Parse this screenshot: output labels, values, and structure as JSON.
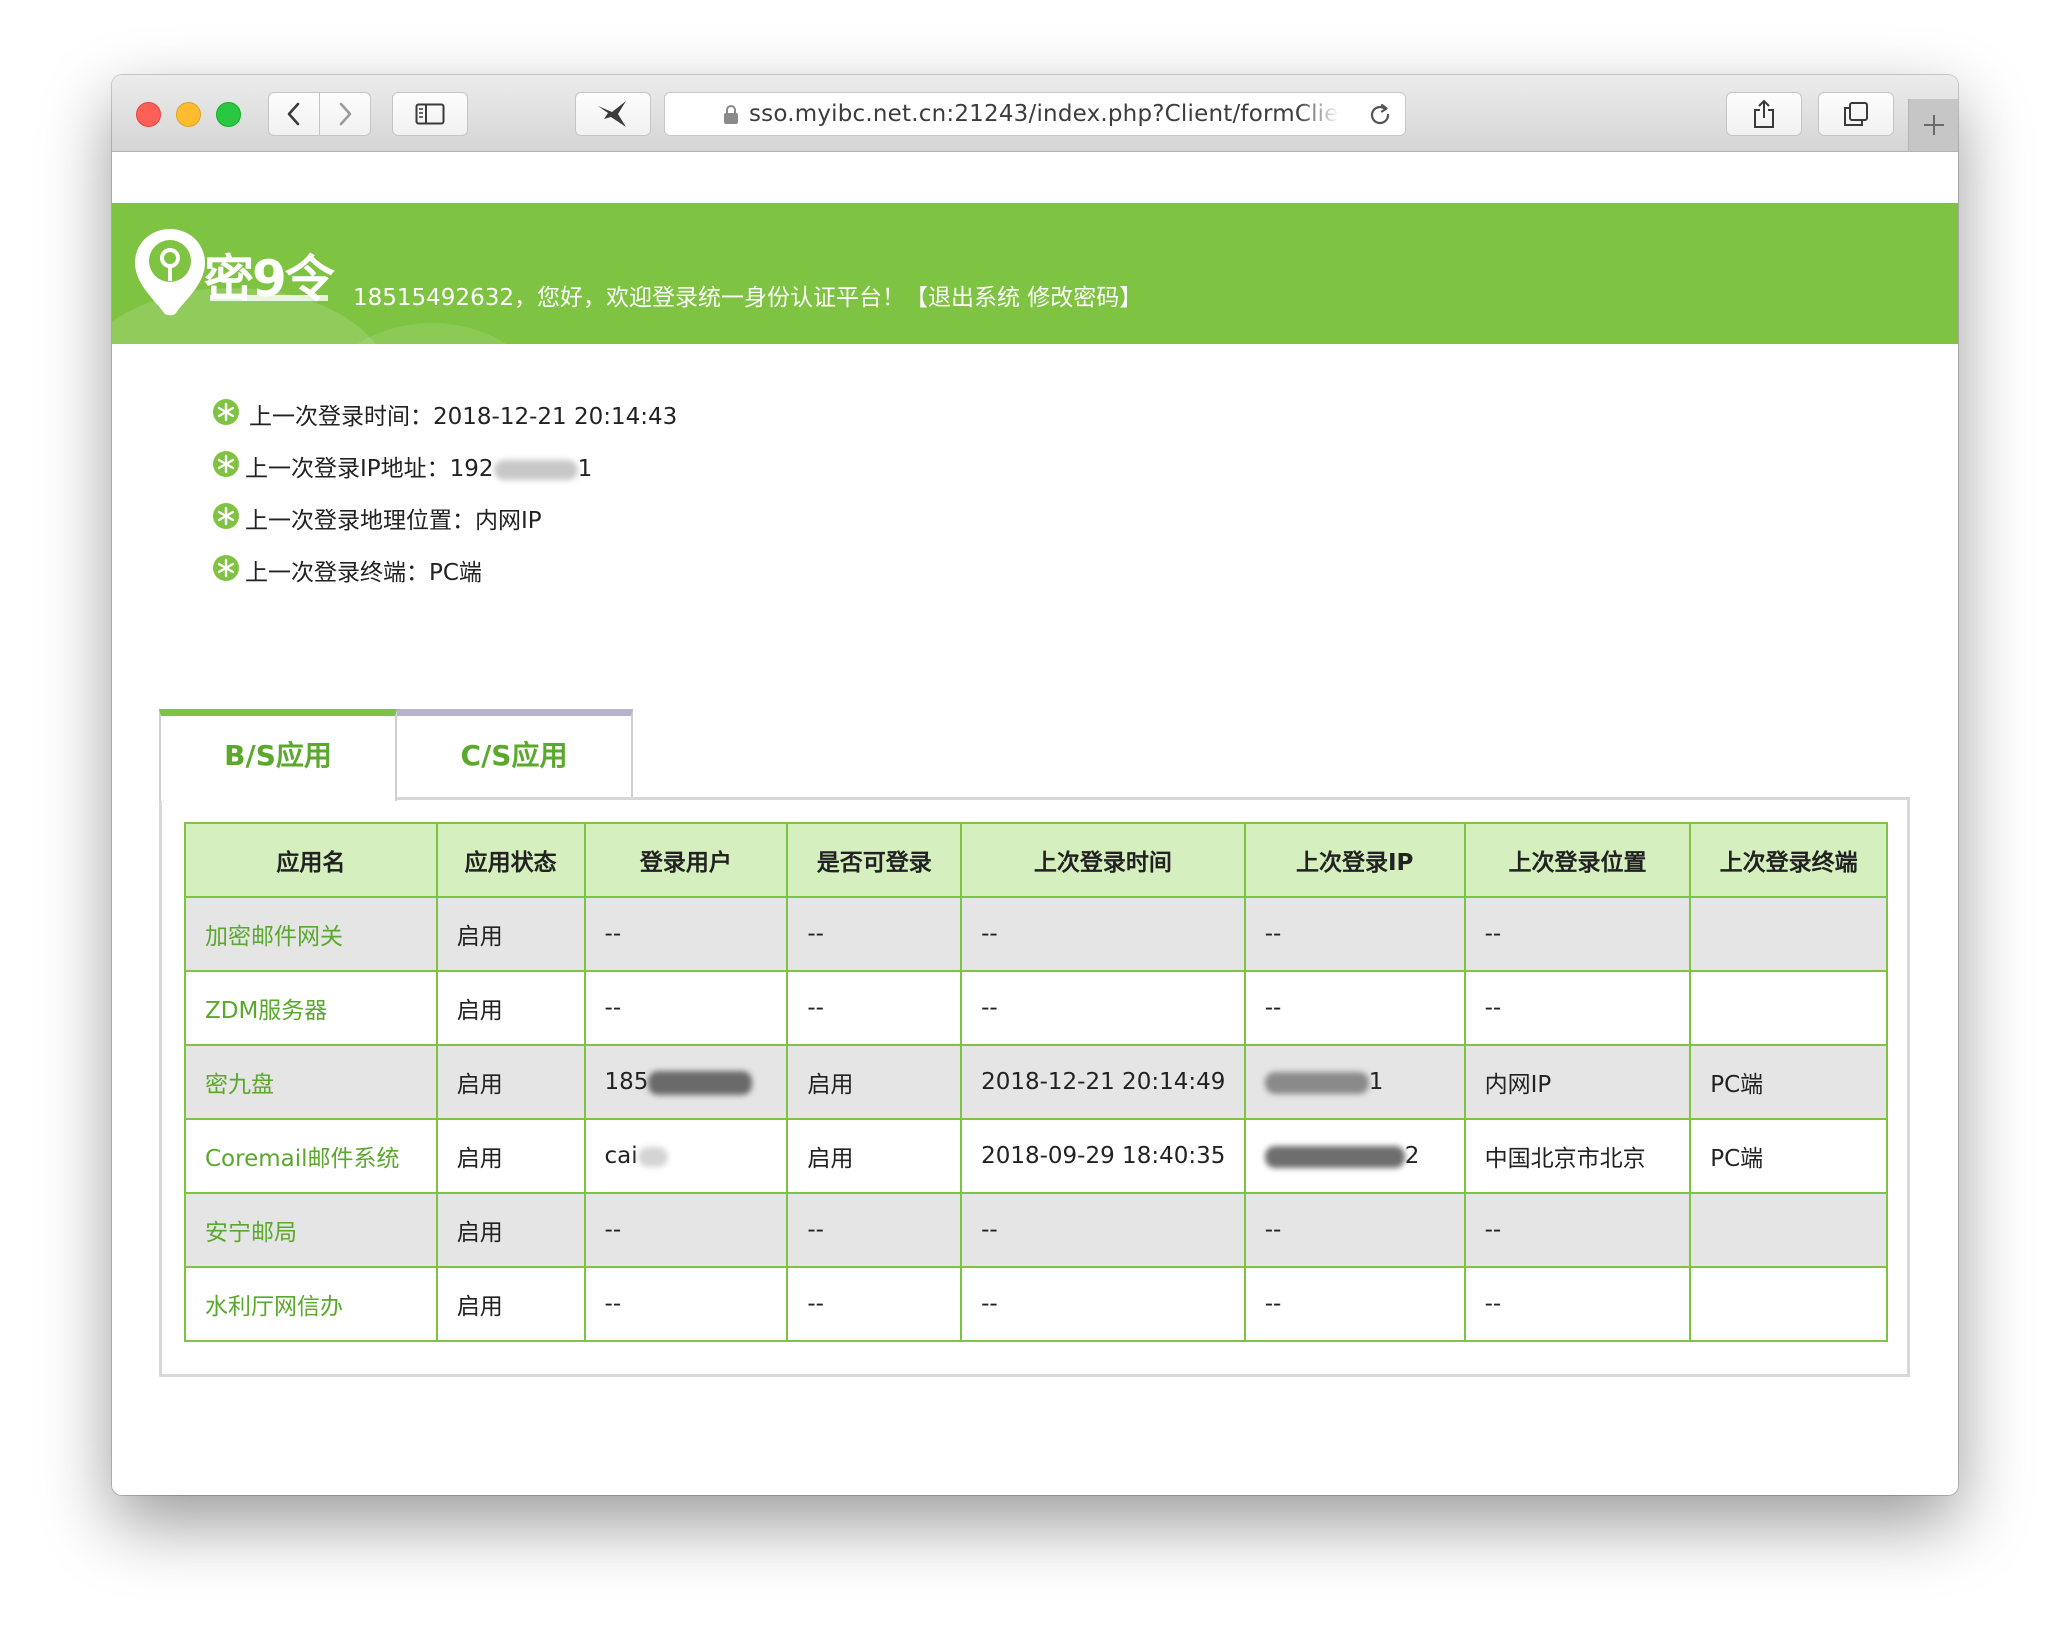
{
  "browser": {
    "url": "sso.myibc.net.cn:21243/index.php?Client/formClien",
    "back_label": "Back",
    "forward_label": "Forward"
  },
  "banner": {
    "logo_text": "密9令",
    "user_phone": "18515492632",
    "greeting": "，您好，欢迎登录统一身份认证平台！",
    "bracket_open": "【",
    "logout": "退出系统",
    "change_password": "修改密码",
    "bracket_close": "】"
  },
  "login_info": [
    {
      "label": "上一次登录时间：",
      "value": "2018-12-21 20:14:43"
    },
    {
      "label": "上一次登录IP地址：",
      "value_prefix": "192",
      "value_suffix": "1"
    },
    {
      "label": "上一次登录地理位置：",
      "value": "内网IP"
    },
    {
      "label": "上一次登录终端：",
      "value": "PC端"
    }
  ],
  "tabs": [
    {
      "label": "B/S应用",
      "active": true
    },
    {
      "label": "C/S应用",
      "active": false
    }
  ],
  "table": {
    "headers": [
      "应用名",
      "应用状态",
      "登录用户",
      "是否可登录",
      "上次登录时间",
      "上次登录IP",
      "上次登录位置",
      "上次登录终端"
    ],
    "rows": [
      {
        "name": "加密邮件网关",
        "status": "启用",
        "user": "--",
        "can_login": "--",
        "time": "--",
        "ip": "--",
        "location": "--",
        "terminal": ""
      },
      {
        "name": "ZDM服务器",
        "status": "启用",
        "user": "--",
        "can_login": "--",
        "time": "--",
        "ip": "--",
        "location": "--",
        "terminal": ""
      },
      {
        "name": "密九盘",
        "status": "启用",
        "user": "185",
        "can_login": "启用",
        "time": "2018-12-21 20:14:49",
        "ip": "1",
        "location": "内网IP",
        "terminal": "PC端"
      },
      {
        "name": "Coremail邮件系统",
        "status": "启用",
        "user": "cai",
        "can_login": "启用",
        "time": "2018-09-29 18:40:35",
        "ip": "2",
        "location": "中国北京市北京",
        "terminal": "PC端"
      },
      {
        "name": "安宁邮局",
        "status": "启用",
        "user": "--",
        "can_login": "--",
        "time": "--",
        "ip": "--",
        "location": "--",
        "terminal": ""
      },
      {
        "name": "水利厅网信办",
        "status": "启用",
        "user": "--",
        "can_login": "--",
        "time": "--",
        "ip": "--",
        "location": "--",
        "terminal": ""
      }
    ]
  },
  "colors": {
    "brand_green": "#7fc342",
    "header_row": "#d5efbf",
    "link_green": "#5aa82c",
    "odd_row": "#e5e5e5"
  },
  "icons": {
    "info_bullet": "snowflake-bullet-icon",
    "lock": "lock-icon",
    "reload": "reload-icon",
    "share": "share-icon",
    "tabs_overview": "tabs-overview-icon",
    "sidebar": "sidebar-icon",
    "bird": "bird-extension-icon",
    "new_tab": "plus-icon"
  }
}
